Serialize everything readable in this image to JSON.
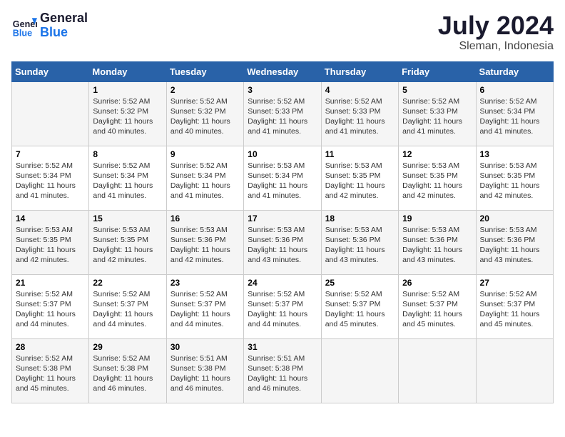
{
  "header": {
    "logo_general": "General",
    "logo_blue": "Blue",
    "month": "July 2024",
    "location": "Sleman, Indonesia"
  },
  "days_of_week": [
    "Sunday",
    "Monday",
    "Tuesday",
    "Wednesday",
    "Thursday",
    "Friday",
    "Saturday"
  ],
  "weeks": [
    [
      {
        "day": "",
        "info": ""
      },
      {
        "day": "1",
        "info": "Sunrise: 5:52 AM\nSunset: 5:32 PM\nDaylight: 11 hours\nand 40 minutes."
      },
      {
        "day": "2",
        "info": "Sunrise: 5:52 AM\nSunset: 5:32 PM\nDaylight: 11 hours\nand 40 minutes."
      },
      {
        "day": "3",
        "info": "Sunrise: 5:52 AM\nSunset: 5:33 PM\nDaylight: 11 hours\nand 41 minutes."
      },
      {
        "day": "4",
        "info": "Sunrise: 5:52 AM\nSunset: 5:33 PM\nDaylight: 11 hours\nand 41 minutes."
      },
      {
        "day": "5",
        "info": "Sunrise: 5:52 AM\nSunset: 5:33 PM\nDaylight: 11 hours\nand 41 minutes."
      },
      {
        "day": "6",
        "info": "Sunrise: 5:52 AM\nSunset: 5:34 PM\nDaylight: 11 hours\nand 41 minutes."
      }
    ],
    [
      {
        "day": "7",
        "info": "Sunrise: 5:52 AM\nSunset: 5:34 PM\nDaylight: 11 hours\nand 41 minutes."
      },
      {
        "day": "8",
        "info": "Sunrise: 5:52 AM\nSunset: 5:34 PM\nDaylight: 11 hours\nand 41 minutes."
      },
      {
        "day": "9",
        "info": "Sunrise: 5:52 AM\nSunset: 5:34 PM\nDaylight: 11 hours\nand 41 minutes."
      },
      {
        "day": "10",
        "info": "Sunrise: 5:53 AM\nSunset: 5:34 PM\nDaylight: 11 hours\nand 41 minutes."
      },
      {
        "day": "11",
        "info": "Sunrise: 5:53 AM\nSunset: 5:35 PM\nDaylight: 11 hours\nand 42 minutes."
      },
      {
        "day": "12",
        "info": "Sunrise: 5:53 AM\nSunset: 5:35 PM\nDaylight: 11 hours\nand 42 minutes."
      },
      {
        "day": "13",
        "info": "Sunrise: 5:53 AM\nSunset: 5:35 PM\nDaylight: 11 hours\nand 42 minutes."
      }
    ],
    [
      {
        "day": "14",
        "info": "Sunrise: 5:53 AM\nSunset: 5:35 PM\nDaylight: 11 hours\nand 42 minutes."
      },
      {
        "day": "15",
        "info": "Sunrise: 5:53 AM\nSunset: 5:35 PM\nDaylight: 11 hours\nand 42 minutes."
      },
      {
        "day": "16",
        "info": "Sunrise: 5:53 AM\nSunset: 5:36 PM\nDaylight: 11 hours\nand 42 minutes."
      },
      {
        "day": "17",
        "info": "Sunrise: 5:53 AM\nSunset: 5:36 PM\nDaylight: 11 hours\nand 43 minutes."
      },
      {
        "day": "18",
        "info": "Sunrise: 5:53 AM\nSunset: 5:36 PM\nDaylight: 11 hours\nand 43 minutes."
      },
      {
        "day": "19",
        "info": "Sunrise: 5:53 AM\nSunset: 5:36 PM\nDaylight: 11 hours\nand 43 minutes."
      },
      {
        "day": "20",
        "info": "Sunrise: 5:53 AM\nSunset: 5:36 PM\nDaylight: 11 hours\nand 43 minutes."
      }
    ],
    [
      {
        "day": "21",
        "info": "Sunrise: 5:52 AM\nSunset: 5:37 PM\nDaylight: 11 hours\nand 44 minutes."
      },
      {
        "day": "22",
        "info": "Sunrise: 5:52 AM\nSunset: 5:37 PM\nDaylight: 11 hours\nand 44 minutes."
      },
      {
        "day": "23",
        "info": "Sunrise: 5:52 AM\nSunset: 5:37 PM\nDaylight: 11 hours\nand 44 minutes."
      },
      {
        "day": "24",
        "info": "Sunrise: 5:52 AM\nSunset: 5:37 PM\nDaylight: 11 hours\nand 44 minutes."
      },
      {
        "day": "25",
        "info": "Sunrise: 5:52 AM\nSunset: 5:37 PM\nDaylight: 11 hours\nand 45 minutes."
      },
      {
        "day": "26",
        "info": "Sunrise: 5:52 AM\nSunset: 5:37 PM\nDaylight: 11 hours\nand 45 minutes."
      },
      {
        "day": "27",
        "info": "Sunrise: 5:52 AM\nSunset: 5:37 PM\nDaylight: 11 hours\nand 45 minutes."
      }
    ],
    [
      {
        "day": "28",
        "info": "Sunrise: 5:52 AM\nSunset: 5:38 PM\nDaylight: 11 hours\nand 45 minutes."
      },
      {
        "day": "29",
        "info": "Sunrise: 5:52 AM\nSunset: 5:38 PM\nDaylight: 11 hours\nand 46 minutes."
      },
      {
        "day": "30",
        "info": "Sunrise: 5:51 AM\nSunset: 5:38 PM\nDaylight: 11 hours\nand 46 minutes."
      },
      {
        "day": "31",
        "info": "Sunrise: 5:51 AM\nSunset: 5:38 PM\nDaylight: 11 hours\nand 46 minutes."
      },
      {
        "day": "",
        "info": ""
      },
      {
        "day": "",
        "info": ""
      },
      {
        "day": "",
        "info": ""
      }
    ]
  ]
}
